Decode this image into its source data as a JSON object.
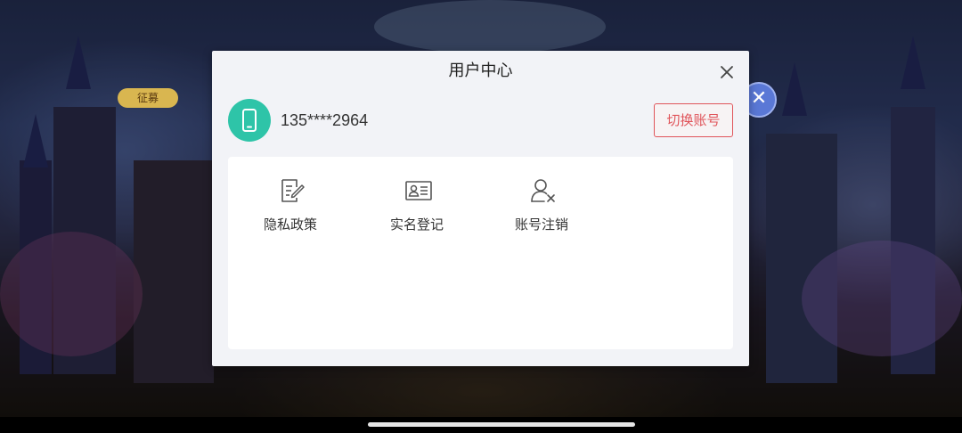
{
  "background": {
    "badge_text": "征募",
    "close_glyph": "✕"
  },
  "dialog": {
    "title": "用户中心",
    "close_icon": "close-icon"
  },
  "account": {
    "phone_number": "135****2964",
    "avatar_icon": "phone-icon",
    "switch_label": "切换账号"
  },
  "menu": {
    "items": [
      {
        "label": "隐私政策",
        "icon": "privacy-policy-icon"
      },
      {
        "label": "实名登记",
        "icon": "id-card-icon"
      },
      {
        "label": "账号注销",
        "icon": "user-remove-icon"
      }
    ]
  },
  "colors": {
    "accent_green": "#2ec4a8",
    "accent_red": "#e0545a"
  }
}
